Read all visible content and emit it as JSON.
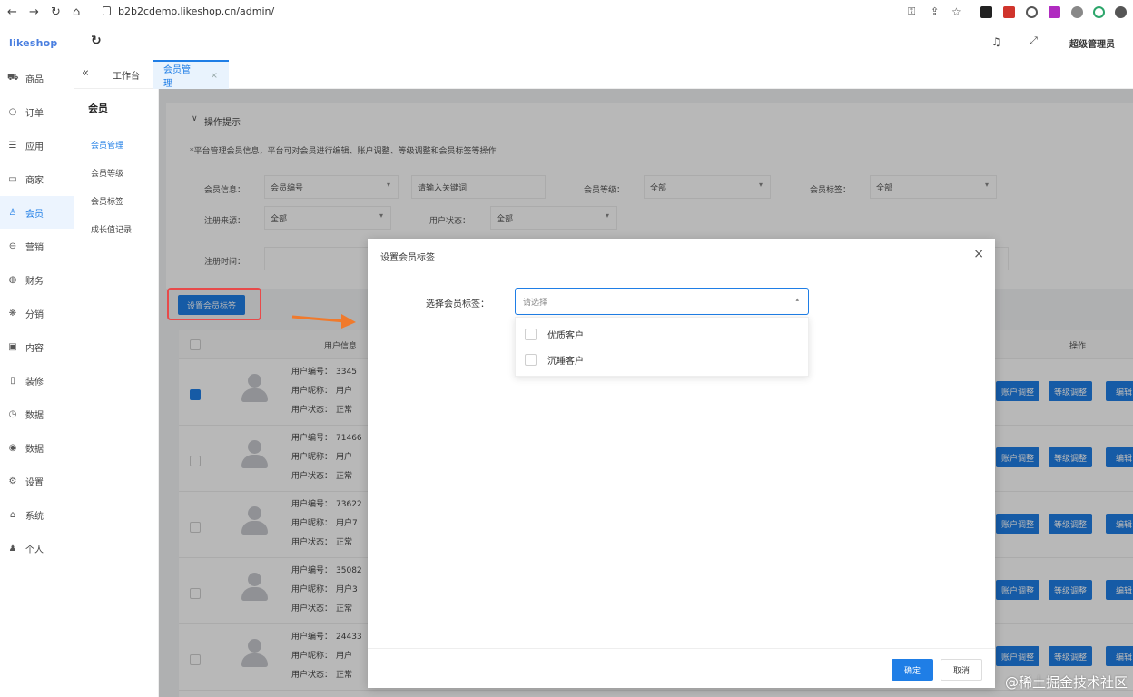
{
  "browser": {
    "url": "b2b2cdemo.likeshop.cn/admin/"
  },
  "sidebar": {
    "logo": "likeshop",
    "items": [
      {
        "icon": "cart-icon",
        "glyph": "⛟",
        "label": "商品"
      },
      {
        "icon": "order-icon",
        "glyph": "○",
        "label": "订单"
      },
      {
        "icon": "app-icon",
        "glyph": "☰",
        "label": "应用"
      },
      {
        "icon": "shop-icon",
        "glyph": "▭",
        "label": "商家"
      },
      {
        "icon": "user-icon",
        "glyph": "♙",
        "label": "会员"
      },
      {
        "icon": "marketing-icon",
        "glyph": "⊖",
        "label": "营销"
      },
      {
        "icon": "finance-icon",
        "glyph": "◍",
        "label": "财务"
      },
      {
        "icon": "distribution-icon",
        "glyph": "❋",
        "label": "分销"
      },
      {
        "icon": "content-icon",
        "glyph": "▣",
        "label": "内容"
      },
      {
        "icon": "decoration-icon",
        "glyph": "▯",
        "label": "装修"
      },
      {
        "icon": "data-icon",
        "glyph": "◷",
        "label": "数据"
      },
      {
        "icon": "stats-icon",
        "glyph": "◉",
        "label": "数据"
      },
      {
        "icon": "settings-icon",
        "glyph": "⚙",
        "label": "设置"
      },
      {
        "icon": "system-icon",
        "glyph": "⌂",
        "label": "系统"
      },
      {
        "icon": "person-icon",
        "glyph": "♟",
        "label": "个人"
      }
    ]
  },
  "topbar": {
    "username": "超级管理员"
  },
  "tabs": {
    "collapse": "«",
    "workbench": "工作台",
    "member_manage": "会员管理",
    "member_manage_close": "×"
  },
  "subnav": {
    "head": "会员",
    "items": [
      "会员管理",
      "会员等级",
      "会员标签",
      "成长值记录"
    ]
  },
  "tips": {
    "title": "操作提示",
    "text": "*平台管理会员信息，平台可对会员进行编辑、账户调整、等级调整和会员标签等操作"
  },
  "filters": {
    "member_info_label": "会员信息：",
    "member_info_select": "会员编号",
    "keyword_placeholder": "请输入关键词",
    "level_label": "会员等级：",
    "level_value": "全部",
    "tag_label": "会员标签：",
    "tag_value": "全部",
    "source_label": "注册来源：",
    "source_value": "全部",
    "status_label": "用户状态：",
    "status_value": "全部",
    "time_label": "注册时间："
  },
  "actions": {
    "set_tag": "设置会员标签"
  },
  "table": {
    "col_user_info": "用户信息",
    "col_actions": "操作",
    "row_labels": [
      "用户编号：",
      "用户昵称：",
      "用户状态："
    ],
    "rows": [
      {
        "checked": true,
        "id": "3345",
        "nick": "用户",
        "status": "正常"
      },
      {
        "checked": false,
        "id": "71466",
        "nick": "用户",
        "status": "正常"
      },
      {
        "checked": false,
        "id": "73622",
        "nick": "用户7",
        "status": "正常"
      },
      {
        "checked": false,
        "id": "35082",
        "nick": "用户3",
        "status": "正常"
      },
      {
        "checked": false,
        "id": "24433",
        "nick": "用户",
        "status": "正常"
      }
    ],
    "btn_account": "账户调整",
    "btn_level": "等级调整",
    "btn_more": "编辑"
  },
  "modal": {
    "title": "设置会员标签",
    "field_label": "选择会员标签：",
    "select_placeholder": "请选择",
    "options": [
      "优质客户",
      "沉睡客户"
    ],
    "confirm": "确定",
    "cancel": "取消"
  },
  "watermark": "@稀土掘金技术社区",
  "colors": {
    "accent": "#1f7ee6",
    "highlight": "#e84a4a",
    "arrow": "#f07a2c"
  }
}
